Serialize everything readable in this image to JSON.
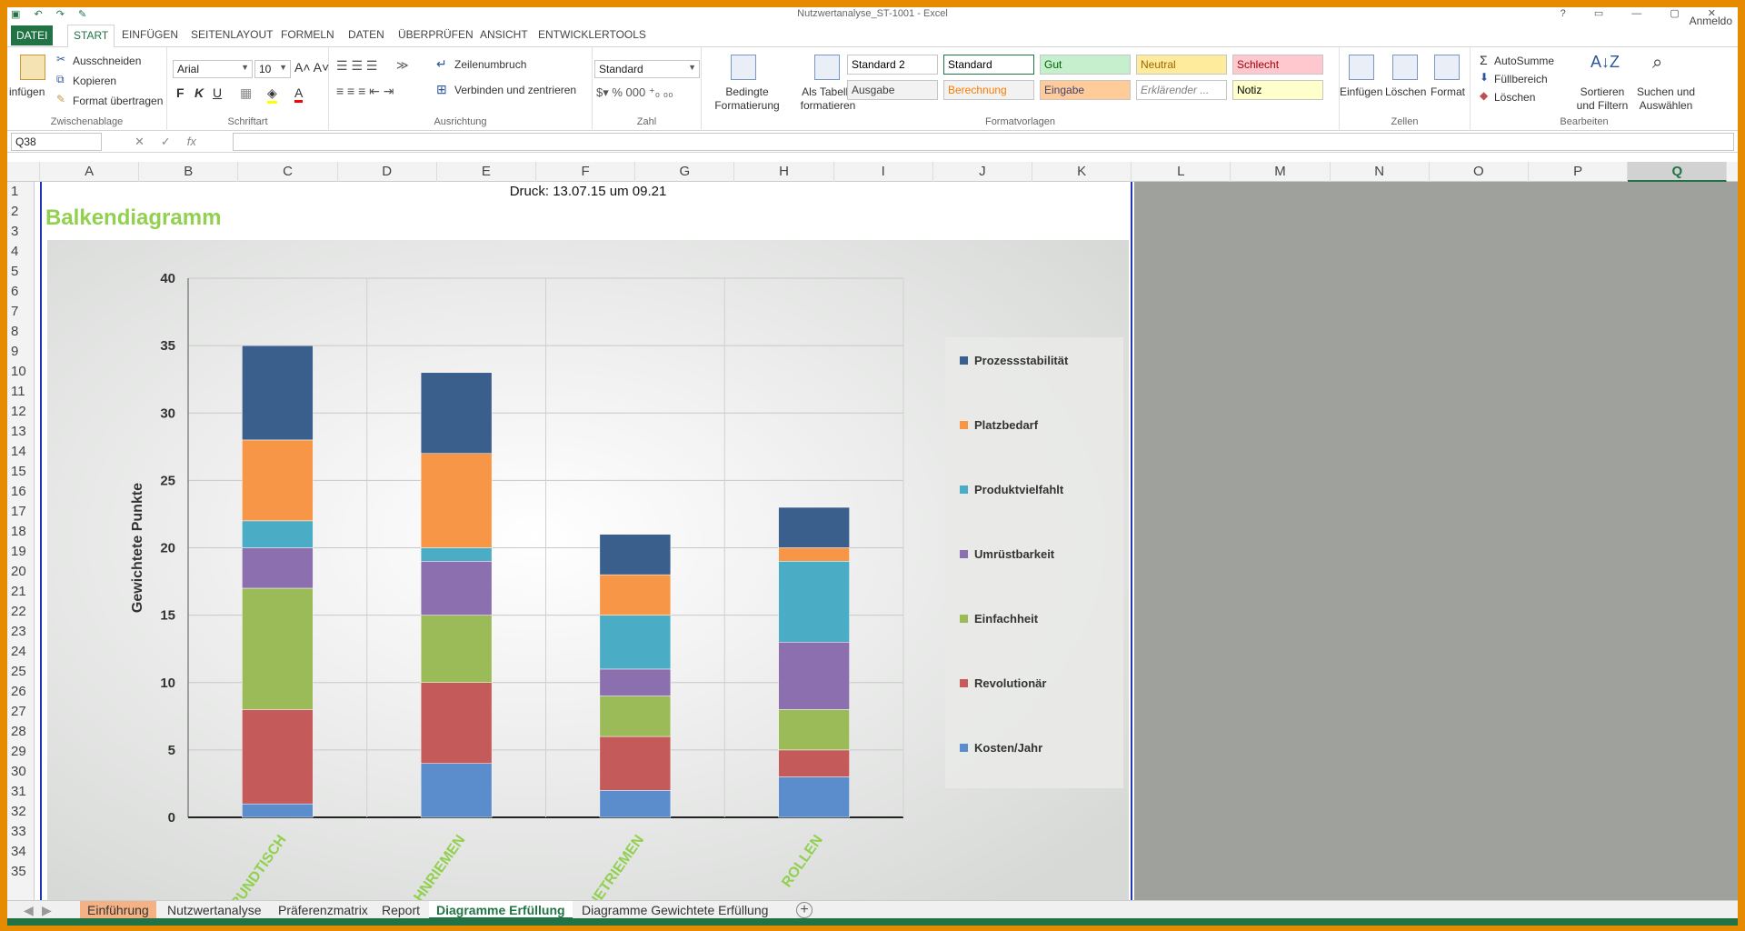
{
  "window": {
    "title": "Nutzwertanalyse_ST-1001 - Excel",
    "sign_in": "Anmeldo"
  },
  "tabs": [
    "DATEI",
    "START",
    "EINFÜGEN",
    "SEITENLAYOUT",
    "FORMELN",
    "DATEN",
    "ÜBERPRÜFEN",
    "ANSICHT",
    "ENTWICKLERTOOLS"
  ],
  "active_tab": "START",
  "ribbon": {
    "clipboard": {
      "paste": "infügen",
      "cut": "Ausschneiden",
      "copy": "Kopieren",
      "format_painter": "Format übertragen",
      "label": "Zwischenablage"
    },
    "font": {
      "name": "Arial",
      "size": "10",
      "label": "Schriftart",
      "bold": "F",
      "italic": "K",
      "underline": "U"
    },
    "alignment": {
      "wrap": "Zeilenumbruch",
      "merge": "Verbinden und zentrieren",
      "label": "Ausrichtung"
    },
    "number": {
      "format": "Standard",
      "label": "Zahl"
    },
    "styles": {
      "conditional": "Bedingte Formatierung",
      "as_table": "Als Tabelle formatieren",
      "label": "Formatvorlagen",
      "cells": [
        {
          "text": "Standard 2",
          "bg": "#ffffff",
          "color": "#000000"
        },
        {
          "text": "Standard",
          "bg": "#ffffff",
          "color": "#000000"
        },
        {
          "text": "Gut",
          "bg": "#c6efce",
          "color": "#006100"
        },
        {
          "text": "Neutral",
          "bg": "#ffeb9c",
          "color": "#9c6500"
        },
        {
          "text": "Schlecht",
          "bg": "#ffc7ce",
          "color": "#9c0006"
        },
        {
          "text": "Ausgabe",
          "bg": "#f2f2f2",
          "color": "#3f3f3f"
        },
        {
          "text": "Berechnung",
          "bg": "#f2f2f2",
          "color": "#fa7d00"
        },
        {
          "text": "Eingabe",
          "bg": "#ffcc99",
          "color": "#3f3f76"
        },
        {
          "text": "Erklärender ...",
          "bg": "#ffffff",
          "color": "#7f7f7f"
        },
        {
          "text": "Notiz",
          "bg": "#ffffcc",
          "color": "#000000"
        }
      ]
    },
    "cells": {
      "insert": "Einfügen",
      "delete": "Löschen",
      "format": "Format",
      "label": "Zellen"
    },
    "editing": {
      "autosum": "AutoSumme",
      "fill": "Füllbereich",
      "clear": "Löschen",
      "sort": "Sortieren und Filtern",
      "find": "Suchen und Auswählen",
      "label": "Bearbeiten"
    }
  },
  "formula_bar": {
    "name_box": "Q38",
    "fx": "fx",
    "value": ""
  },
  "columns": [
    "A",
    "B",
    "C",
    "D",
    "E",
    "F",
    "G",
    "H",
    "I",
    "J",
    "K",
    "L",
    "M",
    "N",
    "O",
    "P",
    "Q"
  ],
  "selected_column": "Q",
  "rows": [
    "1",
    "2",
    "3",
    "4",
    "5",
    "6",
    "7",
    "8",
    "9",
    "10",
    "11",
    "12",
    "13",
    "14",
    "15",
    "16",
    "17",
    "18",
    "19",
    "20",
    "21",
    "22",
    "23",
    "24",
    "25",
    "26",
    "27",
    "28",
    "29",
    "30",
    "31",
    "32",
    "33",
    "34",
    "35"
  ],
  "sheet": {
    "print_date": "Druck: 13.07.15 um 09.21",
    "heading": "Balkendiagramm"
  },
  "sheet_tabs": [
    {
      "label": "Einführung",
      "style": "orange"
    },
    {
      "label": "Nutzwertanalyse",
      "style": ""
    },
    {
      "label": "Präferenzmatrix",
      "style": ""
    },
    {
      "label": "Report",
      "style": ""
    },
    {
      "label": "Diagramme Erfüllung",
      "style": "active"
    },
    {
      "label": "Diagramme Gewichtete Erfüllung",
      "style": ""
    }
  ],
  "chart_data": {
    "type": "bar",
    "stacked": true,
    "ylabel": "Gewichtete Punkte",
    "ylim": [
      0,
      40
    ],
    "yticks": [
      0,
      5,
      10,
      15,
      20,
      25,
      30,
      35,
      40
    ],
    "categories": [
      "RUNDTISCH",
      "ZAHNRIEMEN",
      "MAGNETRIEMEN",
      "ROLLEN"
    ],
    "series": [
      {
        "name": "Kosten/Jahr",
        "color": "#5b8ccc",
        "values": [
          1,
          4,
          2,
          3
        ]
      },
      {
        "name": "Revolutionär",
        "color": "#c55a5a",
        "values": [
          7,
          6,
          4,
          2
        ]
      },
      {
        "name": "Einfachheit",
        "color": "#9bbb59",
        "values": [
          9,
          5,
          3,
          3
        ]
      },
      {
        "name": "Umrüstbarkeit",
        "color": "#8c6fae",
        "values": [
          3,
          4,
          2,
          5
        ]
      },
      {
        "name": "Produktvielfahlt",
        "color": "#4bacc6",
        "values": [
          2,
          1,
          4,
          6
        ]
      },
      {
        "name": "Platzbedarf",
        "color": "#f79646",
        "values": [
          6,
          7,
          3,
          1
        ]
      },
      {
        "name": "Prozessstabilität",
        "color": "#3a5f8c",
        "values": [
          7,
          6,
          3,
          3
        ]
      }
    ],
    "legend_position": "right",
    "grid": true,
    "category_label_color": "#92d050"
  }
}
